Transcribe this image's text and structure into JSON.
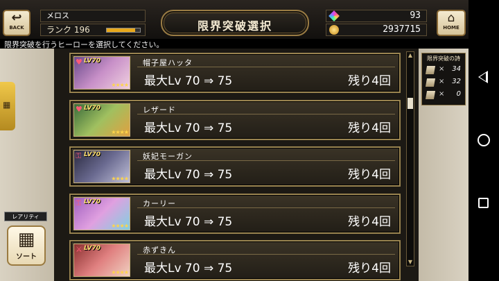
{
  "header": {
    "back_label": "BACK",
    "player_name": "メロス",
    "rank_label": "ランク",
    "rank_value": "196",
    "rank_progress": 0.85,
    "title": "限界突破選択",
    "gems": "93",
    "gold": "2937715",
    "home_label": "HOME"
  },
  "instruction": "限界突破を行うヒーローを選択してください。",
  "left_panel": {
    "rarity_label": "レアリティ",
    "sort_label": "ソート"
  },
  "stones": {
    "title": "限界突破の詩",
    "items": [
      {
        "count": "34"
      },
      {
        "count": "32"
      },
      {
        "count": "0"
      }
    ]
  },
  "heroes": [
    {
      "name": "帽子屋ハッタ",
      "level_text": "LV70",
      "max_lv": "最大Lv 70 ⇒ 75",
      "remaining": "残り4回",
      "favorite": true,
      "icon": "heart-icon"
    },
    {
      "name": "レザード",
      "level_text": "LV70",
      "max_lv": "最大Lv 70 ⇒ 75",
      "remaining": "残り4回",
      "favorite": true,
      "icon": "heart-icon"
    },
    {
      "name": "妖妃モーガン",
      "level_text": "LV70",
      "max_lv": "最大Lv 70 ⇒ 75",
      "remaining": "残り4回",
      "favorite": false,
      "icon": "key-icon"
    },
    {
      "name": "カーリー",
      "level_text": "LV70",
      "max_lv": "最大Lv 70 ⇒ 75",
      "remaining": "残り4回",
      "favorite": false,
      "icon": "key-icon"
    },
    {
      "name": "赤ずきん",
      "level_text": "LV70",
      "max_lv": "最大Lv 70 ⇒ 75",
      "remaining": "残り4回",
      "favorite": false,
      "icon": "sword-icon"
    }
  ],
  "colors": {
    "frame_gold": "#9a8450",
    "panel_bg": "#d9d2c2",
    "rank_bar": "#e8a81a"
  }
}
